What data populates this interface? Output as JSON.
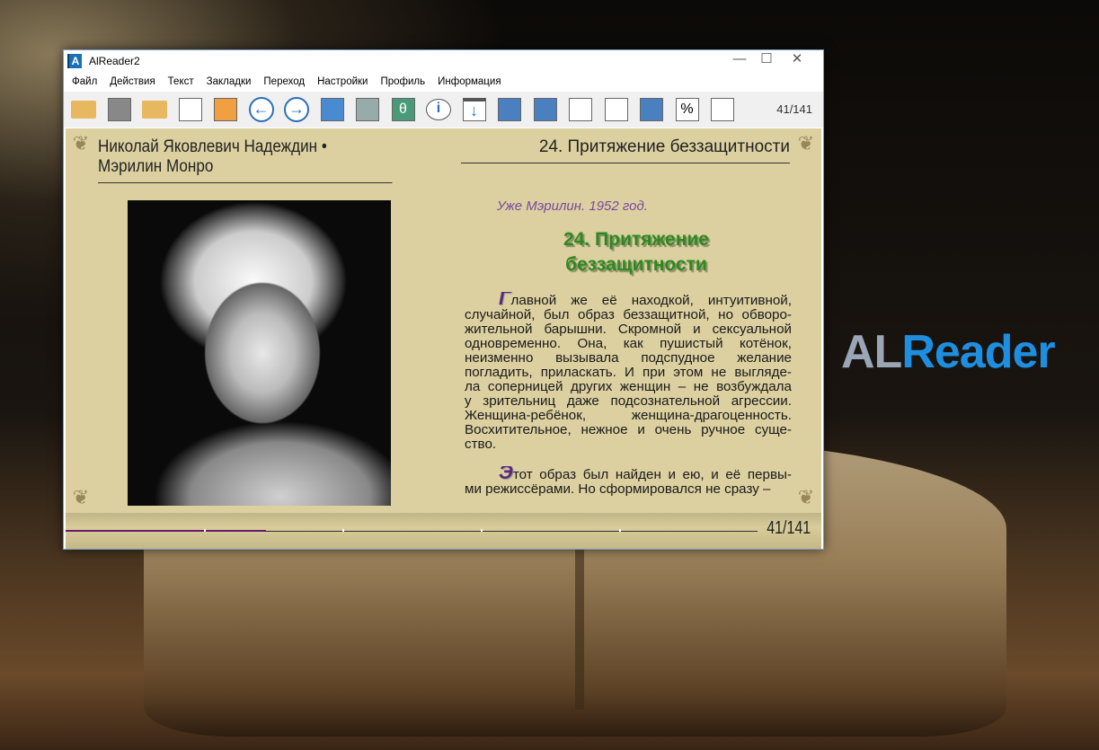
{
  "brand": {
    "part1": "AL",
    "part2": "Reader"
  },
  "window": {
    "title": "AlReader2",
    "icon_letter": "A"
  },
  "menu": [
    "Файл",
    "Действия",
    "Текст",
    "Закладки",
    "Переход",
    "Настройки",
    "Профиль",
    "Информация"
  ],
  "toolbar": {
    "icons": [
      "open-file-add-icon",
      "library-icon",
      "close-file-icon",
      "search-icon",
      "search-text-icon",
      "back-icon",
      "forward-icon",
      "book-info-icon",
      "display-settings-icon",
      "font-icon",
      "info-icon",
      "download-icon",
      "copy-icon",
      "sync-icon",
      "certificate-icon",
      "bookmark-page-icon",
      "rotate-icon",
      "percent-icon",
      "edit-icon"
    ],
    "page_count": "41/141"
  },
  "page": {
    "header_left": "Николай Яковлевич Надеждин • Мэрилин Монро",
    "header_right": "24. Притяжение беззащитности",
    "epigraph": "Уже Мэрилин. 1952 год.",
    "chapter_title_line1": "24. Притяжение",
    "chapter_title_line2": "беззащитности",
    "paragraph1": {
      "drop": "Г",
      "lines": [
        "лавной же её находкой, интуитивной,",
        "случайной, был образ беззащитной, но обворо-",
        "жительной барышни. Скромной и сексуальной",
        "одновременно. Она, как пушистый котёнок,",
        "неизменно вызывала подспудное желание",
        "погладить, приласкать. И при этом не выгляде-",
        "ла соперницей других женщин – не возбуждала",
        "у зрительниц даже подсознательной агрессии.",
        "Женщина-ребёнок,      женщина-драгоценность.",
        "Восхитительное, нежное и очень ручное суще-",
        "ство."
      ]
    },
    "paragraph2": {
      "drop": "Э",
      "lines": [
        "тот образ был найден и ею, и её первы-",
        "ми режиссёрами. Но сформировался не сразу –"
      ]
    },
    "footer_page": "41/141",
    "progress_fraction": 0.29
  }
}
